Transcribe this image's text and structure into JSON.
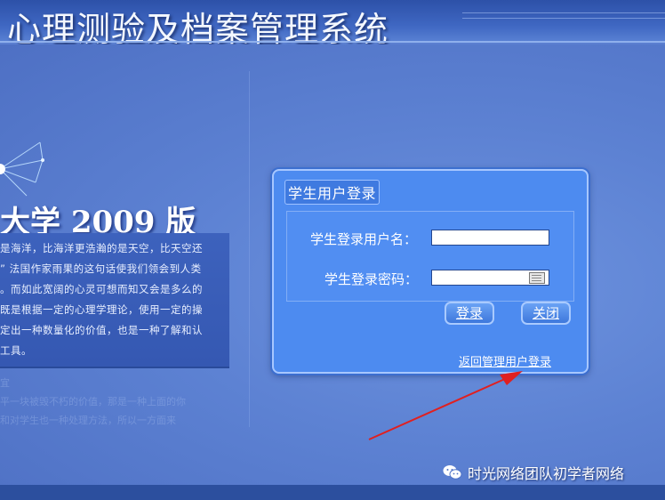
{
  "app": {
    "title": "心理测验及档案管理系统"
  },
  "left_panel": {
    "version_title": "大学 2009 版",
    "intro_lines": [
      "是海洋，比海洋更浩瀚的是天空，比天空还",
      "” 法国作家雨果的这句话使我们领会到人类",
      "。而如此宽阔的心灵可想而知又会是多么的",
      "既是根据一定的心理学理论，使用一定的操",
      "定出一种数量化的价值，也是一种了解和认",
      "工具。"
    ],
    "faded_lines": [
      "宜",
      "平一块被毁不朽的价值，那是一种上面的你",
      "和对学生也一种处理方法，所以一方面来"
    ]
  },
  "login": {
    "title": "学生用户登录",
    "username_label": "学生登录用户名：",
    "username_value": "",
    "password_label": "学生登录密码：",
    "password_value": "",
    "login_button": "登录",
    "close_button": "关闭",
    "return_link": "返回管理用户登录"
  },
  "watermark": {
    "text": "时光网络团队初学者网络"
  },
  "colors": {
    "background": "#5b7fd0",
    "panel": "#4d8bf0",
    "annotation_arrow": "#e02020"
  }
}
